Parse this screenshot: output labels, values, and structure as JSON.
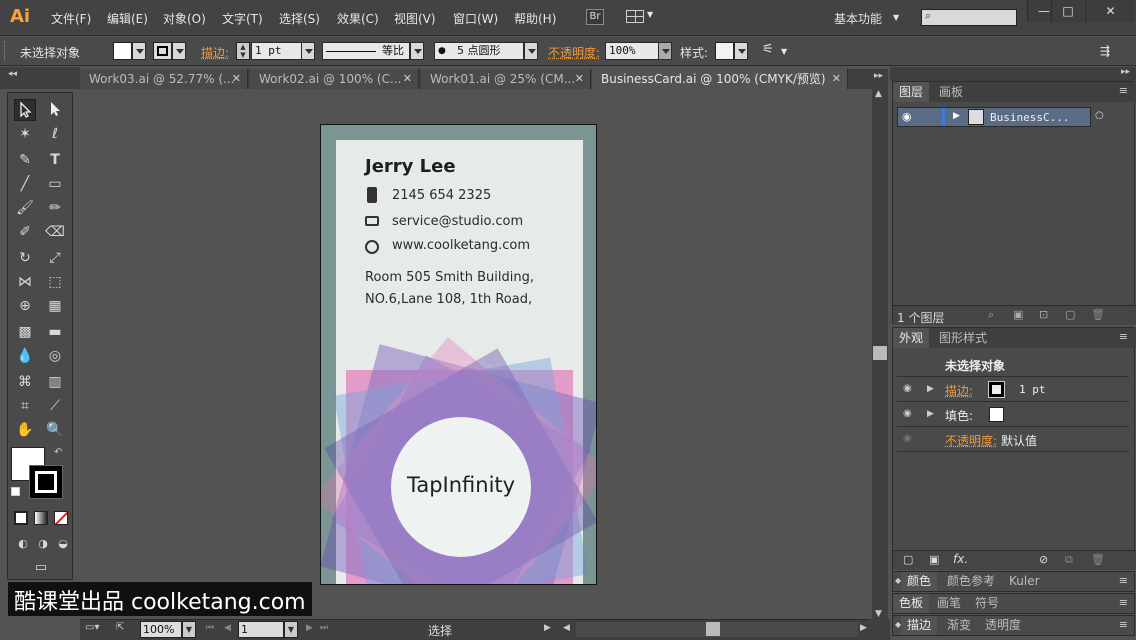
{
  "app": {
    "logo": "Ai",
    "menus": [
      "文件(F)",
      "编辑(E)",
      "对象(O)",
      "文字(T)",
      "选择(S)",
      "效果(C)",
      "视图(V)",
      "窗口(W)",
      "帮助(H)"
    ],
    "bridge_label": "Br",
    "workspace": "基本功能",
    "search_placeholder": "",
    "window_buttons": [
      "—",
      "□",
      "✕"
    ]
  },
  "control_bar": {
    "selection_status": "未选择对象",
    "stroke_label": "描边:",
    "stroke_weight": "1 pt",
    "stroke_profile": "等比",
    "brush": "5 点圆形",
    "opacity_label": "不透明度:",
    "opacity_value": "100%",
    "style_label": "样式:"
  },
  "tabs": [
    {
      "label": "Work03.ai @ 52.77% (...",
      "active": false
    },
    {
      "label": "Work02.ai @ 100% (C...",
      "active": false
    },
    {
      "label": "Work01.ai @ 25% (CM...",
      "active": false
    },
    {
      "label": "BusinessCard.ai @ 100% (CMYK/预览)",
      "active": true
    }
  ],
  "card": {
    "name": "Jerry Lee",
    "phone": "2145 654 2325",
    "email": "service@studio.com",
    "website": "www.coolketang.com",
    "address_line1": "Room 505 Smith Building,",
    "address_line2": "NO.6,Lane 108, 1th Road,",
    "company": "TapInfinity"
  },
  "layers_panel": {
    "tabs": [
      "图层",
      "画板"
    ],
    "layer_name": "BusinessC...",
    "layer_count": "1 个图层"
  },
  "appearance_panel": {
    "tabs": [
      "外观",
      "图形样式"
    ],
    "title": "未选择对象",
    "stroke_label": "描边:",
    "stroke_value": "1 pt",
    "fill_label": "填色:",
    "opacity_label": "不透明度:",
    "opacity_value": "默认值"
  },
  "collapsed_panels": {
    "row1": [
      "颜色",
      "颜色参考",
      "Kuler"
    ],
    "row2": [
      "色板",
      "画笔",
      "符号"
    ],
    "row3": [
      "描边",
      "渐变",
      "透明度"
    ]
  },
  "status_bar": {
    "zoom": "100%",
    "artboard": "1",
    "tool": "选择"
  },
  "watermark": "酷课堂出品 coolketang.com",
  "colors": {
    "accent_orange": "#f19a38",
    "artboard_bg": "#7a9593",
    "card_bg": "#e6ebea",
    "purple": "#6a4bb4",
    "pink": "#e26fb3",
    "blue": "#4f8fd4"
  }
}
